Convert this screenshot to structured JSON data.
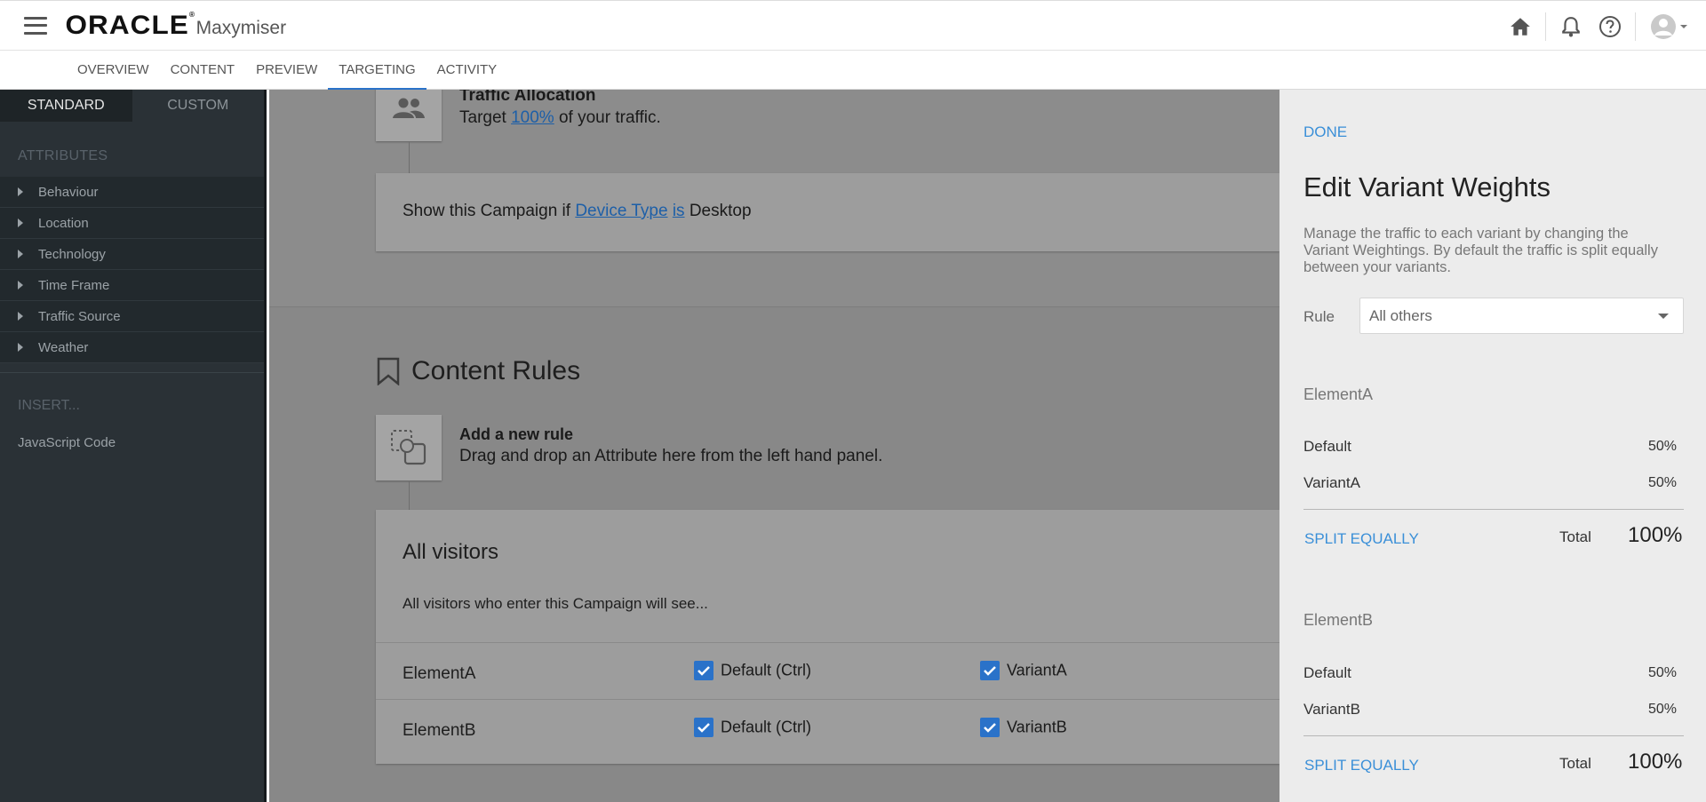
{
  "header": {
    "logo_text": "ORACLE",
    "product_name": "Maxymiser"
  },
  "tabs": [
    "OVERVIEW",
    "CONTENT",
    "PREVIEW",
    "TARGETING",
    "ACTIVITY"
  ],
  "left_panel": {
    "tabs": [
      "STANDARD",
      "CUSTOM"
    ],
    "attributes_title": "ATTRIBUTES",
    "attributes": [
      "Behaviour",
      "Location",
      "Technology",
      "Time Frame",
      "Traffic Source",
      "Weather"
    ],
    "insert_title": "INSERT...",
    "insert_item": "JavaScript Code"
  },
  "main": {
    "traffic": {
      "title": "Traffic Allocation",
      "prefix": "Target",
      "percent": "100%",
      "suffix": "of your traffic."
    },
    "condition": {
      "prefix": "Show this Campaign if",
      "attribute": "Device Type",
      "operator": "is",
      "value": "Desktop"
    },
    "content_rules_title": "Content Rules",
    "new_rule": {
      "title": "Add a new rule",
      "hint": "Drag and drop an Attribute here from the left hand panel."
    },
    "all_visitors": {
      "title": "All visitors",
      "description": "All visitors who enter this Campaign will see...",
      "rows": [
        {
          "element": "ElementA",
          "default_label": "Default (Ctrl)",
          "variant_label": "VariantA"
        },
        {
          "element": "ElementB",
          "default_label": "Default (Ctrl)",
          "variant_label": "VariantB"
        }
      ]
    }
  },
  "right_panel": {
    "done": "DONE",
    "title": "Edit Variant Weights",
    "description": "Manage the traffic to each variant by changing the Variant Weightings. By default the traffic is split equally between your variants.",
    "rule_label": "Rule",
    "rule_value": "All others",
    "groups": [
      {
        "name": "ElementA",
        "rows": [
          {
            "name": "Default",
            "pct": "50%"
          },
          {
            "name": "VariantA",
            "pct": "50%"
          }
        ],
        "split_label": "SPLIT EQUALLY",
        "total_label": "Total",
        "total_value": "100%"
      },
      {
        "name": "ElementB",
        "rows": [
          {
            "name": "Default",
            "pct": "50%"
          },
          {
            "name": "VariantB",
            "pct": "50%"
          }
        ],
        "split_label": "SPLIT EQUALLY",
        "total_label": "Total",
        "total_value": "100%"
      }
    ]
  },
  "colors": {
    "accent_blue": "#2a72c9",
    "link_blue": "#3a8fd8",
    "sidebar_bg": "#2a3136",
    "overlay_gray": "#8c8c8c"
  }
}
